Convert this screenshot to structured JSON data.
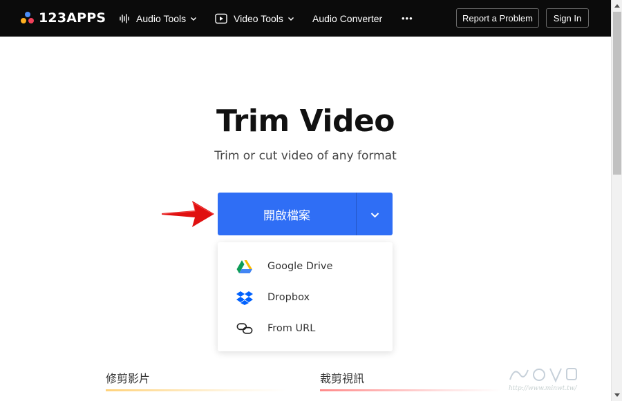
{
  "brand": {
    "name": "123APPS"
  },
  "nav": {
    "audio_tools": "Audio Tools",
    "video_tools": "Video Tools",
    "audio_converter": "Audio Converter",
    "more": "•••"
  },
  "header_buttons": {
    "report": "Report a Problem",
    "signin": "Sign In"
  },
  "page": {
    "title": "Trim Video",
    "subtitle": "Trim or cut video of any format"
  },
  "open_file": {
    "label": "開啟檔案"
  },
  "dropdown": {
    "items": [
      {
        "label": "Google Drive",
        "icon": "google-drive-icon"
      },
      {
        "label": "Dropbox",
        "icon": "dropbox-icon"
      },
      {
        "label": "From URL",
        "icon": "link-icon"
      }
    ]
  },
  "bottom_links": [
    {
      "label": "修剪影片"
    },
    {
      "label": "裁剪視訊"
    }
  ],
  "watermark": {
    "text": "http://www.minwt.tw/"
  },
  "colors": {
    "topbar": "#0b0b0b",
    "primary_button": "#2f6ef5",
    "arrow": "#e01010"
  }
}
